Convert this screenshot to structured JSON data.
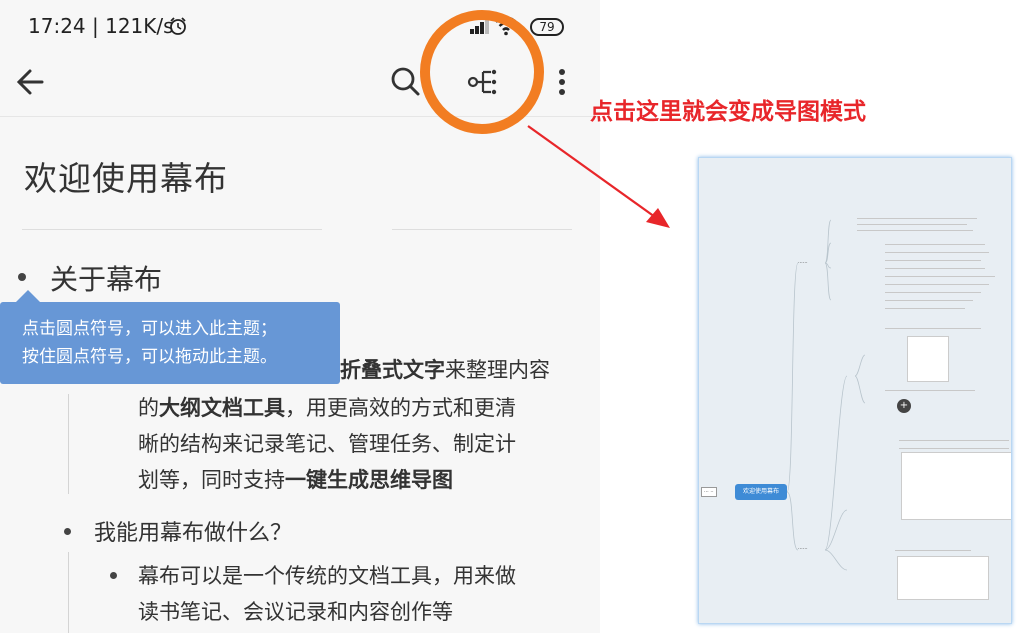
{
  "status_bar": {
    "time_speed": "17:24 | 121K/s",
    "battery": "79"
  },
  "toolbar": {
    "back_icon": "arrow-left-icon",
    "search_icon": "search-icon",
    "mindmap_icon": "mindmap-icon",
    "more_icon": "more-vertical-icon"
  },
  "document": {
    "title": "欢迎使用幕布",
    "topic_about": "关于幕布",
    "tooltip_line1": "点击圆点符号，可以进入此主题；",
    "tooltip_line2": "按住圆点符号，可以拖动此主题。",
    "para_line1_bold": "折叠式文字",
    "para_line1_rest": "来整理内容",
    "para_line2_pre": "的",
    "para_line2_bold": "大纲文档工具",
    "para_line2_rest": "，用更高效的方式和更清",
    "para_line3": "晰的结构来记录笔记、管理任务、制定计",
    "para_line4_pre": "划等，同时支持",
    "para_line4_bold": "一键生成思维导图",
    "topic_can": "我能用幕布做什么？",
    "sub_line1": "幕布可以是一个传统的文档工具，用来做",
    "sub_line2": "读书笔记、会议记录和内容创作等"
  },
  "annotation": {
    "text": "点击这里就会变成导图模式",
    "color": "#e8262a",
    "highlight_color": "#f27d22"
  },
  "mindmap_preview": {
    "root": "欢迎使用幕布"
  }
}
